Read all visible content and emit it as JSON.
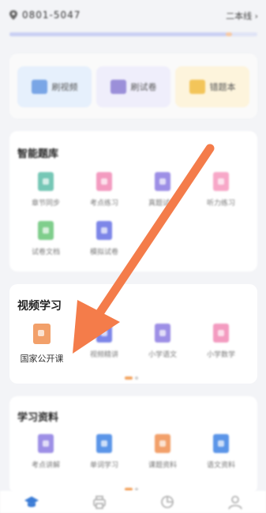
{
  "header": {
    "title": "0801-5047",
    "right_label": "二本线 ›",
    "progress_percent": 88
  },
  "quick_actions": [
    {
      "label": "刷视频",
      "color": "#7aa6e6",
      "bg": "#e6f0fc"
    },
    {
      "label": "刷试卷",
      "color": "#9b8fd9",
      "bg": "#efeefb"
    },
    {
      "label": "错题本",
      "color": "#f3c55a",
      "bg": "#fdf4dc"
    }
  ],
  "smart_bank": {
    "title": "智能题库",
    "items": [
      {
        "label": "章节同步",
        "color": "#76c7b6"
      },
      {
        "label": "考点练习",
        "color": "#f39bc0"
      },
      {
        "label": "真题试卷",
        "color": "#9d8fe6"
      },
      {
        "label": "听力练习",
        "color": "#f7a8c8"
      },
      {
        "label": "试卷文档",
        "color": "#7fce8c"
      },
      {
        "label": "模拟试卷",
        "color": "#7d86e8"
      }
    ]
  },
  "video": {
    "title": "视频学习",
    "items": [
      {
        "label": "国家公开课",
        "color": "#f2a06a"
      },
      {
        "label": "视频精讲",
        "color": "#7d86e8"
      },
      {
        "label": "小学语文",
        "color": "#9d8fe6"
      },
      {
        "label": "小学数学",
        "color": "#f39bc0"
      }
    ]
  },
  "materials": {
    "title": "学习资料",
    "items": [
      {
        "label": "考点讲解",
        "color": "#9d8fe6"
      },
      {
        "label": "单词学习",
        "color": "#5b95e8"
      },
      {
        "label": "课题资料",
        "color": "#f2a06a"
      },
      {
        "label": "语文资料",
        "color": "#5b95e8"
      }
    ]
  },
  "colors": {
    "accent": "#f08a4b",
    "arrow": "#f47c4a",
    "nav_active": "#3a7bd5"
  },
  "nav": [
    "graduation-cap-icon",
    "printer-icon",
    "pie-chart-icon",
    "user-icon"
  ]
}
